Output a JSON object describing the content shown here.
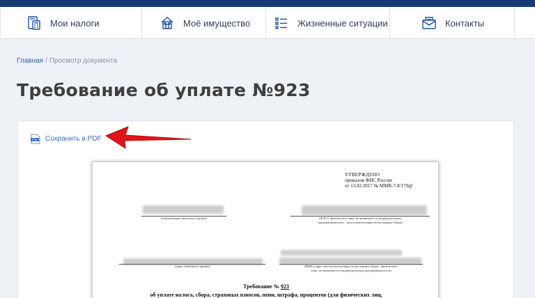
{
  "nav": {
    "items": [
      {
        "label": "Мои налоги",
        "icon": "calculator-document-icon"
      },
      {
        "label": "Моё имущество",
        "icon": "house-icon"
      },
      {
        "label": "Жизненные ситуации",
        "icon": "list-icon"
      },
      {
        "label": "Контакты",
        "icon": "envelope-icon"
      }
    ]
  },
  "breadcrumb": {
    "home": "Главная",
    "separator": "/",
    "current": "Просмотр документа"
  },
  "page": {
    "title": "Требование об уплате №923"
  },
  "actions": {
    "save_pdf": "Сохранить в PDF",
    "pdf_icon_text": "PDF"
  },
  "document": {
    "approved_title": "УТВЕРЖДЕНО",
    "approved_line2": "приказом ФНС России",
    "approved_line3": "от 13.02.2017 № ММВ-7-8/179@",
    "caption_tax_authority": "(наименование налогового органа)",
    "caption_fio_1": "(Ф.И.О. физического лица, не являющегося индивидуальным",
    "caption_fio_2": "предпринимателем, - налогоплательщика (плательщика сбора))",
    "caption_address": "(адрес налогового органа)",
    "caption_inn_1": "(ИНН и адрес налогоплательщика (плательщика сбора) - физического",
    "caption_inn_2": "лица, не являющегося индивидуальным предпринимателем)",
    "req_title_prefix": "Требование №",
    "req_number": "923",
    "req_subtitle": "об уплате налога, сбора, страховых взносов, пени, штрафа, процентов (для физических лиц,"
  },
  "colors": {
    "topbar": "#173b73",
    "link": "#3a6db4",
    "arrow": "#e0141b",
    "title": "#3e3e3e"
  }
}
